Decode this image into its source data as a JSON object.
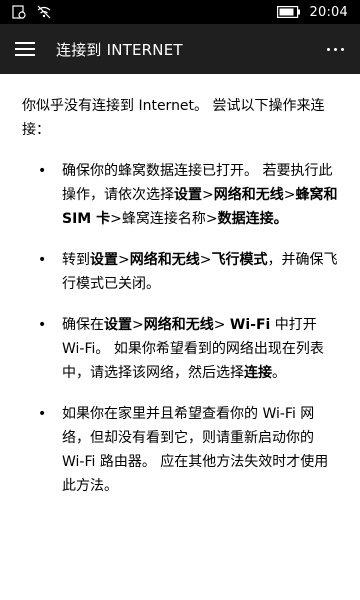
{
  "status_bar": {
    "time": "20:04"
  },
  "app_bar": {
    "title": "连接到 INTERNET"
  },
  "content": {
    "intro": "你似乎没有连接到 Internet。 尝试以下操作来连接：",
    "tips": [
      {
        "segments": [
          {
            "text": "确保你的蜂窝数据连接已打开。 若要执行此操作，请依次选择",
            "bold": false
          },
          {
            "text": "设置",
            "bold": true
          },
          {
            "text": ">",
            "bold": false
          },
          {
            "text": "网络和无线",
            "bold": true
          },
          {
            "text": ">",
            "bold": false
          },
          {
            "text": "蜂窝和 SIM 卡",
            "bold": true
          },
          {
            "text": ">蜂窝连接名称>",
            "bold": false
          },
          {
            "text": "数据连接。",
            "bold": true
          }
        ]
      },
      {
        "segments": [
          {
            "text": "转到",
            "bold": false
          },
          {
            "text": "设置",
            "bold": true
          },
          {
            "text": ">",
            "bold": false
          },
          {
            "text": "网络和无线",
            "bold": true
          },
          {
            "text": ">",
            "bold": false
          },
          {
            "text": "飞行模式",
            "bold": true
          },
          {
            "text": "，并确保飞行模式已关闭。",
            "bold": false
          }
        ]
      },
      {
        "segments": [
          {
            "text": "确保在",
            "bold": false
          },
          {
            "text": "设置",
            "bold": true
          },
          {
            "text": ">",
            "bold": false
          },
          {
            "text": "网络和无线",
            "bold": true
          },
          {
            "text": "> ",
            "bold": false
          },
          {
            "text": "Wi-Fi",
            "bold": true
          },
          {
            "text": " 中打开 Wi-Fi。 如果你希望看到的网络出现在列表中，请选择该网络，然后选择",
            "bold": false
          },
          {
            "text": "连接",
            "bold": true
          },
          {
            "text": "。",
            "bold": false
          }
        ]
      },
      {
        "segments": [
          {
            "text": "如果你在家里并且希望查看你的 Wi-Fi 网络，但却没有看到它，则请重新启动你的 Wi-Fi 路由器。 应在其他方法失效时才使用此方法。",
            "bold": false
          }
        ]
      }
    ]
  }
}
